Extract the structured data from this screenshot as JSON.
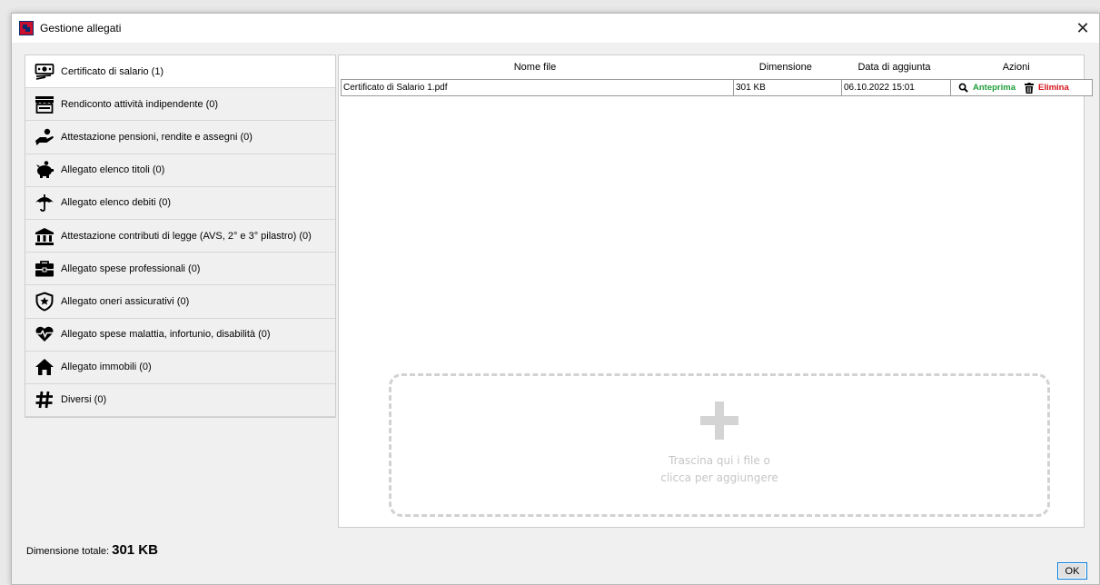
{
  "window": {
    "title": "Gestione allegati",
    "close_glyph": "✕"
  },
  "sidebar": {
    "items": [
      {
        "label": "Certificato di salario (1)",
        "icon": "money-bill-icon",
        "active": true
      },
      {
        "label": "Rendiconto attività indipendente (0)",
        "icon": "storefront-icon",
        "active": false
      },
      {
        "label": "Attestazione pensioni, rendite e assegni (0)",
        "icon": "hand-coin-icon",
        "active": false
      },
      {
        "label": "Allegato elenco titoli (0)",
        "icon": "piggy-bank-icon",
        "active": false
      },
      {
        "label": "Allegato elenco debiti (0)",
        "icon": "umbrella-icon",
        "active": false
      },
      {
        "label": "Attestazione contributi di legge (AVS, 2° e 3° pilastro) (0)",
        "icon": "bank-icon",
        "active": false
      },
      {
        "label": "Allegato spese professionali (0)",
        "icon": "briefcase-icon",
        "active": false
      },
      {
        "label": "Allegato oneri assicurativi (0)",
        "icon": "shield-star-icon",
        "active": false
      },
      {
        "label": "Allegato spese malattia, infortunio, disabilità (0)",
        "icon": "heartbeat-icon",
        "active": false
      },
      {
        "label": "Allegato immobili (0)",
        "icon": "house-icon",
        "active": false
      },
      {
        "label": "Diversi (0)",
        "icon": "hashtag-icon",
        "active": false
      }
    ]
  },
  "table": {
    "columns": [
      "Nome file",
      "Dimensione",
      "Data di aggiunta",
      "Azioni"
    ],
    "rows": [
      {
        "name": "Certificato di Salario 1.pdf",
        "size": "301 KB",
        "date": "06.10.2022 15:01",
        "preview_label": "Anteprima",
        "delete_label": "Elimina"
      }
    ]
  },
  "dropzone": {
    "line1": "Trascina qui i file o",
    "line2": "clicca per aggiungere"
  },
  "footer": {
    "total_label": "Dimensione totale:",
    "total_value": "301 KB",
    "ok_label": "OK"
  },
  "colors": {
    "preview": "#1e9e3a",
    "delete": "#d4121b",
    "app_icon_red": "#c8102e",
    "app_icon_blue": "#0a2a6b"
  }
}
